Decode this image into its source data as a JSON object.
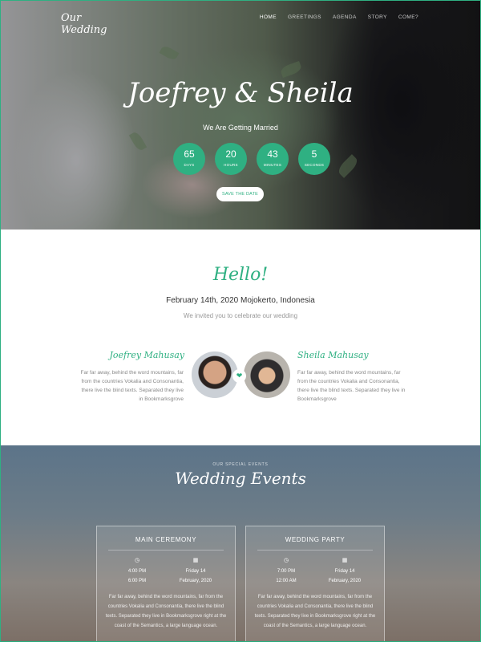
{
  "header": {
    "logo_line1": "Our",
    "logo_line2": "Wedding",
    "nav": [
      "HOME",
      "GREETINGS",
      "AGENDA",
      "STORY",
      "COME?"
    ]
  },
  "hero": {
    "title": "Joefrey & Sheila",
    "tagline": "We Are Getting Married",
    "countdown": [
      {
        "value": "65",
        "label": "DAYS"
      },
      {
        "value": "20",
        "label": "HOURS"
      },
      {
        "value": "43",
        "label": "MINUTES"
      },
      {
        "value": "5",
        "label": "SECONDS"
      }
    ],
    "button": "SAVE THE DATE"
  },
  "greeting": {
    "title": "Hello!",
    "date_line": "February 14th, 2020 Mojokerto, Indonesia",
    "invite": "We invited you to celebrate our wedding",
    "groom": {
      "name": "Joefrey Mahusay",
      "bio": "Far far away, behind the word mountains, far from the countries Vokalia and Consonantia, there live the blind texts. Separated they live in Bookmarksgrove"
    },
    "bride": {
      "name": "Sheila Mahusay",
      "bio": "Far far away, behind the word mountains, far from the countries Vokalia and Consonantia, there live the blind texts. Separated they live in Bookmarksgrove"
    }
  },
  "events": {
    "subtitle": "OUR SPECIAL EVENTS",
    "title": "Wedding Events",
    "cards": [
      {
        "title": "MAIN CEREMONY",
        "time_start": "4:00 PM",
        "time_end": "6:00 PM",
        "day": "Friday 14",
        "month": "February, 2020",
        "text": "Far far away, behind the word mountains, far from the countries Vokalia and Consonantia, there live the blind texts. Separated they live in Bookmarksgrove right at the coast of the Semantics, a large language ocean."
      },
      {
        "title": "WEDDING PARTY",
        "time_start": "7:00 PM",
        "time_end": "12:00 AM",
        "day": "Friday 14",
        "month": "February, 2020",
        "text": "Far far away, behind the word mountains, far from the countries Vokalia and Consonantia, there live the blind texts. Separated they live in Bookmarksgrove right at the coast of the Semantics, a large language ocean."
      }
    ]
  },
  "colors": {
    "accent": "#2fb082"
  },
  "icons": {
    "heart": "heart-icon",
    "clock": "clock-icon",
    "calendar": "calendar-icon"
  }
}
